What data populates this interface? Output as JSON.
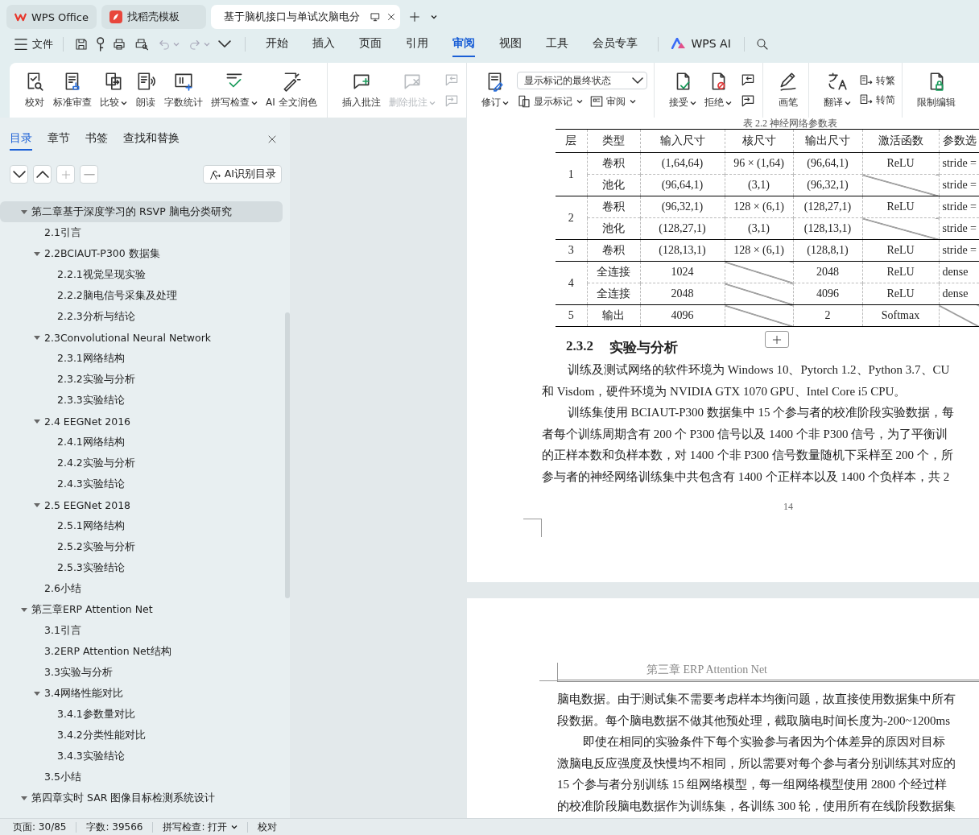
{
  "tabs": [
    {
      "label": "WPS Office",
      "selected": false
    },
    {
      "label": "找稻壳模板",
      "selected": false
    },
    {
      "label": "基于脑机接口与单试次脑电分",
      "selected": true
    }
  ],
  "menu": {
    "file": "文件",
    "tabs": [
      {
        "label": "开始",
        "selected": false
      },
      {
        "label": "插入",
        "selected": false
      },
      {
        "label": "页面",
        "selected": false
      },
      {
        "label": "引用",
        "selected": false
      },
      {
        "label": "审阅",
        "selected": true
      },
      {
        "label": "视图",
        "selected": false
      },
      {
        "label": "工具",
        "selected": false
      },
      {
        "label": "会员专享",
        "selected": false
      }
    ],
    "ai": "WPS AI"
  },
  "ribbon": {
    "groups": [
      {
        "items": [
          {
            "kind": "large",
            "label": "校对",
            "dropdown": false,
            "disabled": false
          },
          {
            "kind": "large",
            "label": "标准审查",
            "dropdown": false,
            "disabled": false
          },
          {
            "kind": "large",
            "label": "比较",
            "dropdown": true,
            "disabled": false
          },
          {
            "kind": "large",
            "label": "朗读",
            "dropdown": false,
            "disabled": false
          },
          {
            "kind": "large",
            "label": "字数统计",
            "dropdown": false,
            "disabled": false
          },
          {
            "kind": "large",
            "label": "拼写检查",
            "dropdown": true,
            "disabled": false
          },
          {
            "kind": "large",
            "label": "AI 全文润色",
            "dropdown": false,
            "disabled": false
          }
        ]
      },
      {
        "items": [
          {
            "kind": "large",
            "label": "插入批注",
            "dropdown": false,
            "disabled": false
          },
          {
            "kind": "large",
            "label": "删除批注",
            "dropdown": true,
            "disabled": true
          },
          {
            "kind": "stack",
            "top": [
              {
                "kind": "icon",
                "disabled": true
              }
            ],
            "bottom": [
              {
                "kind": "icon",
                "disabled": true
              }
            ]
          }
        ]
      },
      {
        "items": [
          {
            "kind": "large",
            "label": "修订",
            "dropdown": true,
            "disabled": false
          },
          {
            "kind": "stack",
            "top": [
              {
                "kind": "select",
                "value": "显示标记的最终状态"
              }
            ],
            "bottom": [
              {
                "kind": "small",
                "label": "显示标记",
                "dropdown": true,
                "disabled": false
              },
              {
                "kind": "small",
                "label": "审阅",
                "dropdown": true,
                "disabled": false
              }
            ]
          }
        ]
      },
      {
        "items": [
          {
            "kind": "large",
            "label": "接受",
            "dropdown": true,
            "disabled": false
          },
          {
            "kind": "large",
            "label": "拒绝",
            "dropdown": true,
            "disabled": false
          },
          {
            "kind": "stack",
            "top": [
              {
                "kind": "icon",
                "disabled": false
              }
            ],
            "bottom": [
              {
                "kind": "icon",
                "disabled": false
              }
            ]
          }
        ]
      },
      {
        "items": [
          {
            "kind": "large",
            "label": "画笔",
            "dropdown": false,
            "disabled": false
          }
        ]
      },
      {
        "items": [
          {
            "kind": "large",
            "label": "翻译",
            "dropdown": true,
            "disabled": false
          },
          {
            "kind": "stack",
            "top": [
              {
                "kind": "small",
                "label": "转繁",
                "dropdown": false,
                "disabled": false
              }
            ],
            "bottom": [
              {
                "kind": "small",
                "label": "转简",
                "dropdown": false,
                "disabled": false
              }
            ]
          }
        ]
      },
      {
        "items": [
          {
            "kind": "large",
            "label": "限制编辑",
            "dropdown": false,
            "disabled": false
          }
        ]
      }
    ]
  },
  "sidebar": {
    "tabs": [
      {
        "label": "目录",
        "selected": true
      },
      {
        "label": "章节",
        "selected": false
      },
      {
        "label": "书签",
        "selected": false
      },
      {
        "label": "查找和替换",
        "selected": false
      }
    ],
    "ai_button": "AI识别目录",
    "toc": [
      {
        "label": "第二章基于深度学习的 RSVP 脑电分类研究",
        "selected": true,
        "expanded": true,
        "children": [
          {
            "label": "2.1引言",
            "selected": false
          },
          {
            "label": "2.2BCIAUT-P300 数据集",
            "selected": false,
            "expanded": true,
            "children": [
              {
                "label": "2.2.1视觉呈现实验",
                "selected": false
              },
              {
                "label": "2.2.2脑电信号采集及处理",
                "selected": false
              },
              {
                "label": "2.2.3分析与结论",
                "selected": false
              }
            ]
          },
          {
            "label": "2.3Convolutional Neural Network",
            "selected": false,
            "expanded": true,
            "children": [
              {
                "label": "2.3.1网络结构",
                "selected": false
              },
              {
                "label": "2.3.2实验与分析",
                "selected": false
              },
              {
                "label": "2.3.3实验结论",
                "selected": false
              }
            ]
          },
          {
            "label": "2.4  EEGNet 2016",
            "selected": false,
            "expanded": true,
            "children": [
              {
                "label": "2.4.1网络结构",
                "selected": false
              },
              {
                "label": "2.4.2实验与分析",
                "selected": false
              },
              {
                "label": "2.4.3实验结论",
                "selected": false
              }
            ]
          },
          {
            "label": "2.5  EEGNet 2018",
            "selected": false,
            "expanded": true,
            "children": [
              {
                "label": "2.5.1网络结构",
                "selected": false
              },
              {
                "label": "2.5.2实验与分析",
                "selected": false
              },
              {
                "label": "2.5.3实验结论",
                "selected": false
              }
            ]
          },
          {
            "label": "2.6小结",
            "selected": false
          }
        ]
      },
      {
        "label": "第三章ERP Attention Net",
        "selected": false,
        "expanded": true,
        "children": [
          {
            "label": "3.1引言",
            "selected": false
          },
          {
            "label": "3.2ERP Attention Net结构",
            "selected": false
          },
          {
            "label": "3.3实验与分析",
            "selected": false
          },
          {
            "label": "3.4网络性能对比",
            "selected": false,
            "expanded": true,
            "children": [
              {
                "label": "3.4.1参数量对比",
                "selected": false
              },
              {
                "label": "3.4.2分类性能对比",
                "selected": false
              },
              {
                "label": "3.4.3实验结论",
                "selected": false
              }
            ]
          },
          {
            "label": "3.5小结",
            "selected": false
          }
        ]
      },
      {
        "label": "第四章实时 SAR 图像目标检测系统设计",
        "selected": false,
        "expanded": true
      }
    ]
  },
  "document": {
    "page1": {
      "caption": "表 2.2 神经网络参数表",
      "table": {
        "columns": [
          "层",
          "类型",
          "输入尺寸",
          "核尺寸",
          "输出尺寸",
          "激活函数",
          "参数选"
        ],
        "groups": [
          {
            "layer": "1",
            "rows": [
              {
                "cells": [
                  "卷积",
                  "(1,64,64)",
                  "96 × (1,64)",
                  "(96,64,1)",
                  "ReLU",
                  "stride ="
                ]
              },
              {
                "cells": [
                  "池化",
                  "(96,64,1)",
                  "(3,1)",
                  "(96,32,1)",
                  {
                    "kind": "diagonal"
                  },
                  "stride ="
                ]
              }
            ]
          },
          {
            "layer": "2",
            "rows": [
              {
                "cells": [
                  "卷积",
                  "(96,32,1)",
                  "128 × (6,1)",
                  "(128,27,1)",
                  "ReLU",
                  "stride ="
                ]
              },
              {
                "cells": [
                  "池化",
                  "(128,27,1)",
                  "(3,1)",
                  "(128,13,1)",
                  {
                    "kind": "diagonal"
                  },
                  "stride ="
                ]
              }
            ]
          },
          {
            "layer": "3",
            "rows": [
              {
                "cells": [
                  "卷积",
                  "(128,13,1)",
                  "128 × (6,1)",
                  "(128,8,1)",
                  "ReLU",
                  "stride ="
                ]
              }
            ]
          },
          {
            "layer": "4",
            "rows": [
              {
                "cells": [
                  "全连接",
                  "1024",
                  {
                    "kind": "diagonal"
                  },
                  "2048",
                  "ReLU",
                  "dense"
                ]
              },
              {
                "cells": [
                  "全连接",
                  "2048",
                  {
                    "kind": "diagonal"
                  },
                  "4096",
                  "ReLU",
                  "dense"
                ]
              }
            ]
          },
          {
            "layer": "5",
            "rows": [
              {
                "cells": [
                  "输出",
                  "4096",
                  {
                    "kind": "diagonal"
                  },
                  "2",
                  "Softmax",
                  {
                    "kind": "diagonal"
                  }
                ]
              }
            ]
          }
        ]
      },
      "heading": {
        "number": "2.3.2",
        "title": "实验与分析"
      },
      "lines": [
        {
          "text": "训练及测试网络的软件环境为 Windows 10、Pytorch 1.2、Python 3.7、CU",
          "indent": true
        },
        {
          "text": "和 Visdom，硬件环境为 NVIDIA GTX 1070 GPU、Intel Core i5 CPU。",
          "indent": false
        },
        {
          "text": "训练集使用 BCIAUT-P300 数据集中 15 个参与者的校准阶段实验数据，每",
          "indent": true
        },
        {
          "text": "者每个训练周期含有 200 个 P300 信号以及 1400 个非 P300 信号，为了平衡训",
          "indent": false
        },
        {
          "text": "的正样本数和负样本数，对 1400 个非 P300 信号数量随机下采样至 200 个，所",
          "indent": false
        },
        {
          "text": "参与者的神经网络训练集中共包含有 1400 个正样本以及 1400 个负样本，共 2",
          "indent": false
        }
      ],
      "page_number": "14"
    },
    "page2": {
      "header": "第三章  ERP Attention Net",
      "lines": [
        {
          "text": "脑电数据。由于测试集不需要考虑样本均衡问题，故直接使用数据集中所有",
          "indent": false
        },
        {
          "text": "段数据。每个脑电数据不做其他预处理，截取脑电时间长度为-200~1200ms",
          "indent": false
        },
        {
          "text": "即使在相同的实验条件下每个实验参与者因为个体差异的原因对目标",
          "indent": true
        },
        {
          "text": "激脑电反应强度及快慢均不相同，所以需要对每个参与者分别训练其对应的",
          "indent": false
        },
        {
          "text": "15 个参与者分别训练 15 组网络模型，每一组网络模型使用 2800 个经过样",
          "indent": false
        },
        {
          "text": "的校准阶段脑电数据作为训练集，各训练 300 轮，使用所有在线阶段数据集",
          "indent": false
        }
      ]
    }
  },
  "status_bar": {
    "page": "页面: 30/85",
    "words": "字数: 39566",
    "spellcheck": "拼写检查: 打开",
    "proofread": "校对"
  }
}
